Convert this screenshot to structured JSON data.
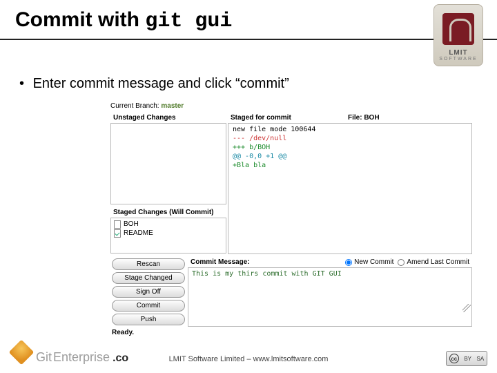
{
  "slide": {
    "title_prefix": "Commit with ",
    "title_code": "git gui",
    "bullet": "Enter commit message and click “commit”"
  },
  "git_gui": {
    "branch_label": "Current Branch:",
    "branch_name": "master",
    "unstaged_label": "Unstaged Changes",
    "staged_label": "Staged Changes (Will Commit)",
    "staged_files": [
      {
        "name": "BOH",
        "checked": false
      },
      {
        "name": "README",
        "checked": true
      }
    ],
    "diff_header_left": "Staged for commit",
    "diff_header_right": "File: BOH",
    "diff_lines": {
      "mode": "new file mode 100644",
      "minus": "--- /dev/null",
      "plus": "+++ b/BOH",
      "hunk": "@@ -0,0 +1 @@",
      "added": "+Bla bla"
    },
    "commit_msg_label": "Commit Message:",
    "radio_new": "New Commit",
    "radio_amend": "Amend Last Commit",
    "buttons": {
      "rescan": "Rescan",
      "stage": "Stage Changed",
      "signoff": "Sign Off",
      "commit": "Commit",
      "push": "Push"
    },
    "commit_message": "This is my thirs commit with GIT GUI",
    "status": "Ready."
  },
  "footer": {
    "logo_git": "Git",
    "logo_enterprise": "Enterprise",
    "logo_suffix": ".co",
    "center": "LMIT Software Limited – www.lmitsoftware.com",
    "brand": "LMIT",
    "brand_sub": "SOFTWARE",
    "cc_by": "BY",
    "cc_sa": "SA"
  }
}
